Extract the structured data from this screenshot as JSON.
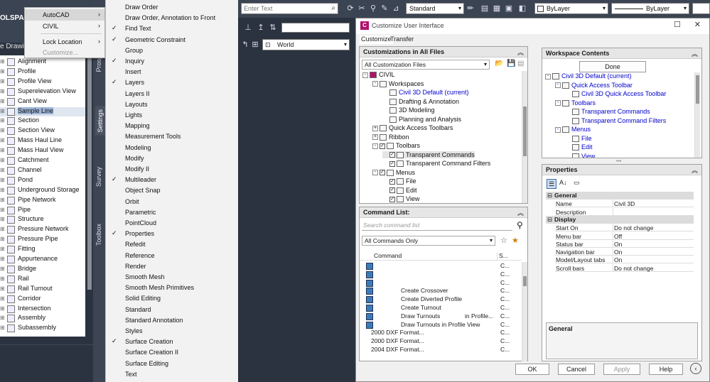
{
  "toolspace": {
    "title": "OLSPACE",
    "drawing_label": "e Drawin",
    "items": [
      {
        "label": "Alignment"
      },
      {
        "label": "Profile"
      },
      {
        "label": "Profile View"
      },
      {
        "label": "Superelevation View"
      },
      {
        "label": "Cant View"
      },
      {
        "label": "Sample Line",
        "selected": true
      },
      {
        "label": "Section"
      },
      {
        "label": "Section View"
      },
      {
        "label": "Mass Haul Line"
      },
      {
        "label": "Mass Haul View"
      },
      {
        "label": "Catchment"
      },
      {
        "label": "Channel"
      },
      {
        "label": "Pond"
      },
      {
        "label": "Underground Storage"
      },
      {
        "label": "Pipe Network"
      },
      {
        "label": "Pipe"
      },
      {
        "label": "Structure"
      },
      {
        "label": "Pressure Network"
      },
      {
        "label": "Pressure Pipe"
      },
      {
        "label": "Fitting"
      },
      {
        "label": "Appurtenance"
      },
      {
        "label": "Bridge"
      },
      {
        "label": "Rail"
      },
      {
        "label": "Rail Turnout"
      },
      {
        "label": "Corridor"
      },
      {
        "label": "Intersection"
      },
      {
        "label": "Assembly"
      },
      {
        "label": "Subassembly"
      }
    ],
    "side_tabs": [
      "Prosp",
      "Settings",
      "Survey",
      "Toolbox"
    ]
  },
  "context_menu": {
    "items": [
      {
        "label": "AutoCAD",
        "submenu": true,
        "highlighted": true
      },
      {
        "label": "CIVIL",
        "submenu": true
      },
      {
        "label": "Lock Location",
        "submenu": true
      },
      {
        "label": "Customize...",
        "disabled": true
      }
    ]
  },
  "submenu": {
    "items": [
      {
        "label": "Draw Order",
        "checked": false
      },
      {
        "label": "Draw Order, Annotation to Front",
        "checked": false
      },
      {
        "label": "Find Text",
        "checked": true
      },
      {
        "label": "Geometric Constraint",
        "checked": true
      },
      {
        "label": "Group",
        "checked": false
      },
      {
        "label": "Inquiry",
        "checked": true
      },
      {
        "label": "Insert",
        "checked": false
      },
      {
        "label": "Layers",
        "checked": true
      },
      {
        "label": "Layers II",
        "checked": false
      },
      {
        "label": "Layouts",
        "checked": false
      },
      {
        "label": "Lights",
        "checked": false
      },
      {
        "label": "Mapping",
        "checked": false
      },
      {
        "label": "Measurement Tools",
        "checked": false
      },
      {
        "label": "Modeling",
        "checked": false
      },
      {
        "label": "Modify",
        "checked": false
      },
      {
        "label": "Modify II",
        "checked": false
      },
      {
        "label": "Multileader",
        "checked": true
      },
      {
        "label": "Object Snap",
        "checked": false
      },
      {
        "label": "Orbit",
        "checked": false
      },
      {
        "label": "Parametric",
        "checked": false
      },
      {
        "label": "PointCloud",
        "checked": false
      },
      {
        "label": "Properties",
        "checked": true
      },
      {
        "label": "Refedit",
        "checked": false
      },
      {
        "label": "Reference",
        "checked": false
      },
      {
        "label": "Render",
        "checked": false
      },
      {
        "label": "Smooth Mesh",
        "checked": false
      },
      {
        "label": "Smooth Mesh Primitives",
        "checked": false
      },
      {
        "label": "Solid Editing",
        "checked": false
      },
      {
        "label": "Standard",
        "checked": false
      },
      {
        "label": "Standard Annotation",
        "checked": false
      },
      {
        "label": "Styles",
        "checked": false
      },
      {
        "label": "Surface Creation",
        "checked": true
      },
      {
        "label": "Surface Creation II",
        "checked": false
      },
      {
        "label": "Surface Editing",
        "checked": false
      },
      {
        "label": "Text",
        "checked": false
      }
    ]
  },
  "toolbar": {
    "search_placeholder": "Enter Text",
    "style_value": "Standard",
    "layer_value": "ByLayer",
    "linetype_value": "ByLayer",
    "ucs_value": "World"
  },
  "dialog": {
    "title": "Customize User Interface",
    "tabs": [
      "Customize",
      "Transfer"
    ],
    "customizations_panel": {
      "header": "Customizations in All Files",
      "filter": "All Customization Files",
      "tree": [
        {
          "label": "CIVIL",
          "depth": 0,
          "expand": "-"
        },
        {
          "label": "Workspaces",
          "depth": 1,
          "expand": "-"
        },
        {
          "label": "Civil 3D Default (current)",
          "depth": 2,
          "blue": true
        },
        {
          "label": "Drafting & Annotation",
          "depth": 2
        },
        {
          "label": "3D Modeling",
          "depth": 2
        },
        {
          "label": "Planning and Analysis",
          "depth": 2
        },
        {
          "label": "Quick Access Toolbars",
          "depth": 1,
          "expand": "+"
        },
        {
          "label": "Ribbon",
          "depth": 1,
          "expand": "+"
        },
        {
          "label": "Toolbars",
          "depth": 1,
          "expand": "-",
          "check": true
        },
        {
          "label": "Transparent Commands",
          "depth": 2,
          "check": true,
          "highlight": true
        },
        {
          "label": "Transparent Command Filters",
          "depth": 2,
          "check": true
        },
        {
          "label": "Menus",
          "depth": 1,
          "expand": "-",
          "check": true
        },
        {
          "label": "File",
          "depth": 2,
          "check": true
        },
        {
          "label": "Edit",
          "depth": 2,
          "check": true
        },
        {
          "label": "View",
          "depth": 2,
          "check": true
        }
      ]
    },
    "command_list": {
      "header": "Command List:",
      "search_placeholder": "Search command list",
      "filter": "All Commands Only",
      "col_command": "Command",
      "col_source": "S...",
      "rows": [
        {
          "name": "",
          "source": "C..."
        },
        {
          "name": "",
          "source": "C..."
        },
        {
          "name": "",
          "source": "C..."
        },
        {
          "name": "Create Crossover",
          "source": "C..."
        },
        {
          "name": "Create Diverted Profile",
          "source": "C..."
        },
        {
          "name": "Create Turnout",
          "source": "C..."
        },
        {
          "name": "Draw Turnouts",
          "extra": "in Profile...",
          "source": "C..."
        },
        {
          "name": "Draw Turnouts in Profile View",
          "source": "C..."
        },
        {
          "name": "2000 DXF Format...",
          "source": "C..."
        },
        {
          "name": "2000 DXF Format...",
          "source": "C..."
        },
        {
          "name": "2004 DXF Format...",
          "source": "C..."
        }
      ]
    },
    "workspace_contents": {
      "header": "Workspace Contents",
      "done_label": "Done",
      "tree": [
        {
          "label": "Civil 3D Default (current)",
          "depth": 0,
          "expand": "-"
        },
        {
          "label": "Quick Access Toolbar",
          "depth": 1,
          "expand": "-"
        },
        {
          "label": "Civil 3D Quick Access Toolbar",
          "depth": 2
        },
        {
          "label": "Toolbars",
          "depth": 1,
          "expand": "-"
        },
        {
          "label": "Transparent Commands",
          "depth": 2
        },
        {
          "label": "Transparent Command Filters",
          "depth": 2
        },
        {
          "label": "Menus",
          "depth": 1,
          "expand": "-"
        },
        {
          "label": "File",
          "depth": 2
        },
        {
          "label": "Edit",
          "depth": 2
        },
        {
          "label": "View",
          "depth": 2
        }
      ]
    },
    "properties": {
      "header": "Properties",
      "categories": [
        {
          "name": "General",
          "rows": [
            {
              "key": "Name",
              "value": "Civil 3D"
            },
            {
              "key": "Description",
              "value": ""
            }
          ]
        },
        {
          "name": "Display",
          "rows": [
            {
              "key": "Start On",
              "value": "Do not change"
            },
            {
              "key": "Menu bar",
              "value": "Off"
            },
            {
              "key": "Status bar",
              "value": "On"
            },
            {
              "key": "Navigation bar",
              "value": "On"
            },
            {
              "key": "Model/Layout tabs",
              "value": "On"
            },
            {
              "key": "Scroll bars",
              "value": "Do not change"
            }
          ]
        }
      ],
      "description_title": "General"
    },
    "buttons": {
      "ok": "OK",
      "cancel": "Cancel",
      "apply": "Apply",
      "help": "Help"
    }
  }
}
